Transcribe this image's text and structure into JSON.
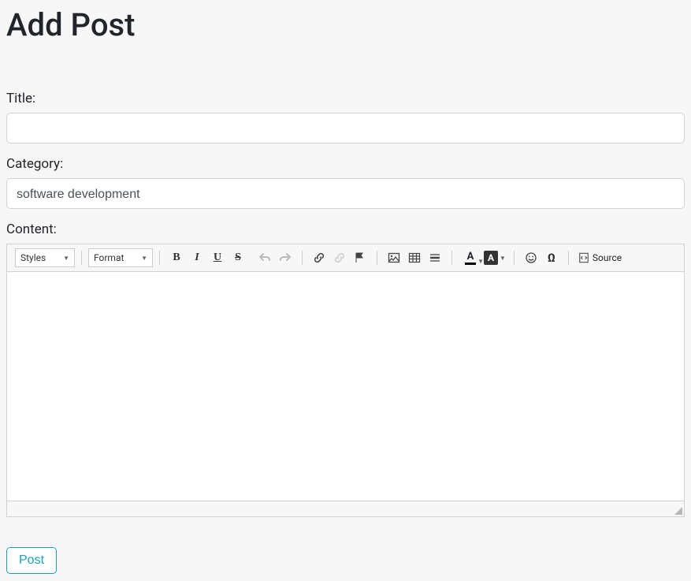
{
  "page": {
    "heading": "Add Post"
  },
  "fields": {
    "title": {
      "label": "Title:",
      "value": ""
    },
    "category": {
      "label": "Category:",
      "value": "software development"
    },
    "content": {
      "label": "Content:"
    }
  },
  "toolbar": {
    "styles": "Styles",
    "format": "Format",
    "source": "Source"
  },
  "buttons": {
    "submit": "Post"
  }
}
